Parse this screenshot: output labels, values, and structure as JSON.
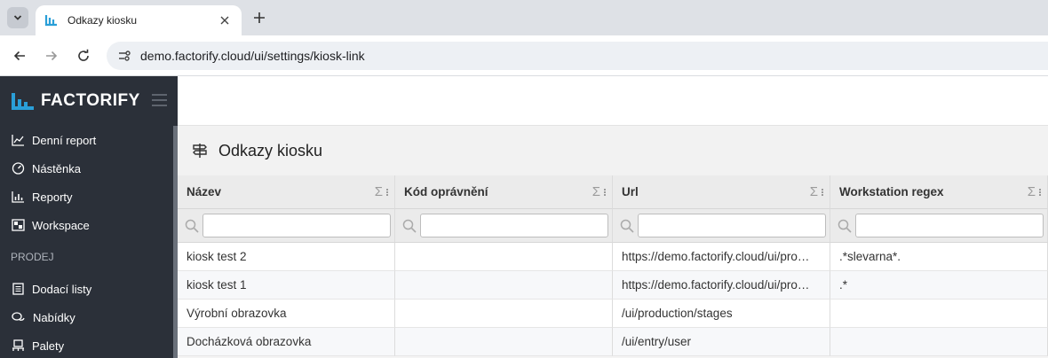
{
  "browser": {
    "tab_title": "Odkazy kiosku",
    "url": "demo.factorify.cloud/ui/settings/kiosk-link"
  },
  "sidebar": {
    "logo": "FACTORIFY",
    "items": [
      {
        "label": "Denní report",
        "icon": "chart-line-icon"
      },
      {
        "label": "Nástěnka",
        "icon": "dashboard-gauge-icon"
      },
      {
        "label": "Reporty",
        "icon": "bar-chart-icon"
      },
      {
        "label": "Workspace",
        "icon": "workspace-icon"
      }
    ],
    "section": "PRODEJ",
    "section_items": [
      {
        "label": "Dodací listy",
        "icon": "document-list-icon"
      },
      {
        "label": "Nabídky",
        "icon": "chat-bubbles-icon"
      },
      {
        "label": "Palety",
        "icon": "pallet-icon"
      }
    ]
  },
  "page": {
    "title": "Odkazy kiosku",
    "title_icon": "signpost-icon"
  },
  "grid": {
    "columns": [
      "Název",
      "Kód oprávnění",
      "Url",
      "Workstation regex"
    ],
    "filter_placeholder": "",
    "rows": [
      [
        "kiosk test 2",
        "",
        "https://demo.factorify.cloud/ui/pro…",
        ".*slevarna*."
      ],
      [
        "kiosk test 1",
        "",
        "https://demo.factorify.cloud/ui/pro…",
        ".*"
      ],
      [
        "Výrobní obrazovka",
        "",
        "/ui/production/stages",
        ""
      ],
      [
        "Docházková obrazovka",
        "",
        "/ui/entry/user",
        ""
      ]
    ]
  },
  "colors": {
    "sidebar_bg": "#2b3039",
    "brand_blue": "#2a9fd8"
  }
}
